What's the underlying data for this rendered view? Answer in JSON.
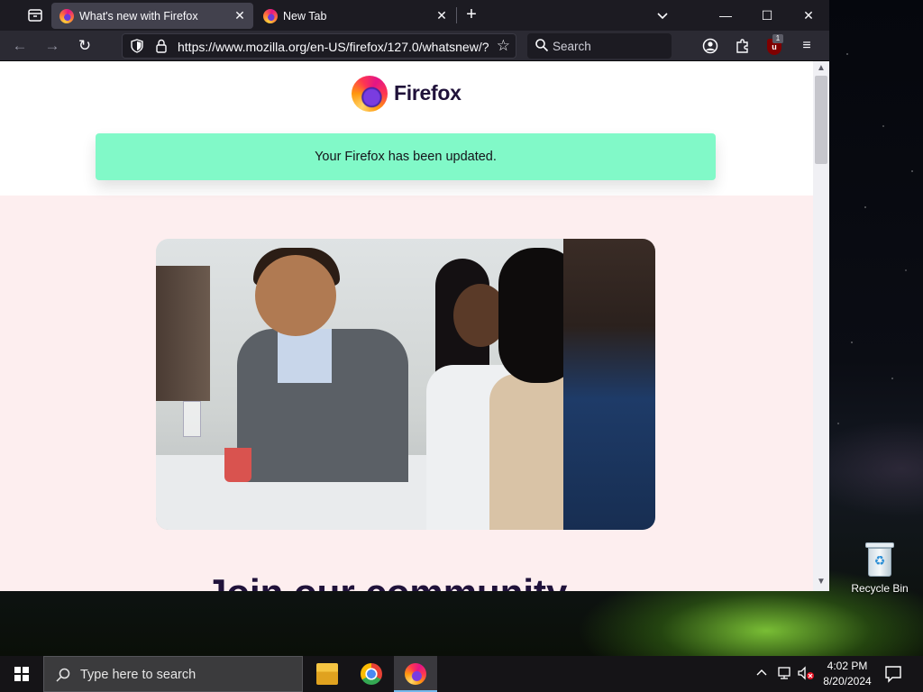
{
  "browser": {
    "tabs": [
      {
        "title": "What's new with Firefox",
        "active": true
      },
      {
        "title": "New Tab",
        "active": false
      }
    ],
    "url": "https://www.mozilla.org/en-US/firefox/127.0/whatsnew/?",
    "search_placeholder": "Search",
    "extension_badge": "1"
  },
  "page": {
    "brand": "Firefox",
    "notice": "Your Firefox has been updated.",
    "headline": "Join our community"
  },
  "desktop": {
    "recycle_bin_label": "Recycle Bin"
  },
  "taskbar": {
    "search_placeholder": "Type here to search",
    "time": "4:02 PM",
    "date": "8/20/2024",
    "apps": [
      "file-explorer",
      "chrome",
      "firefox"
    ]
  },
  "colors": {
    "notice_bg": "#81f9c8",
    "page_band": "#fdeeef",
    "brand_text": "#20123a",
    "tab_strip": "#1c1b22",
    "nav_bar": "#2b2a33"
  }
}
